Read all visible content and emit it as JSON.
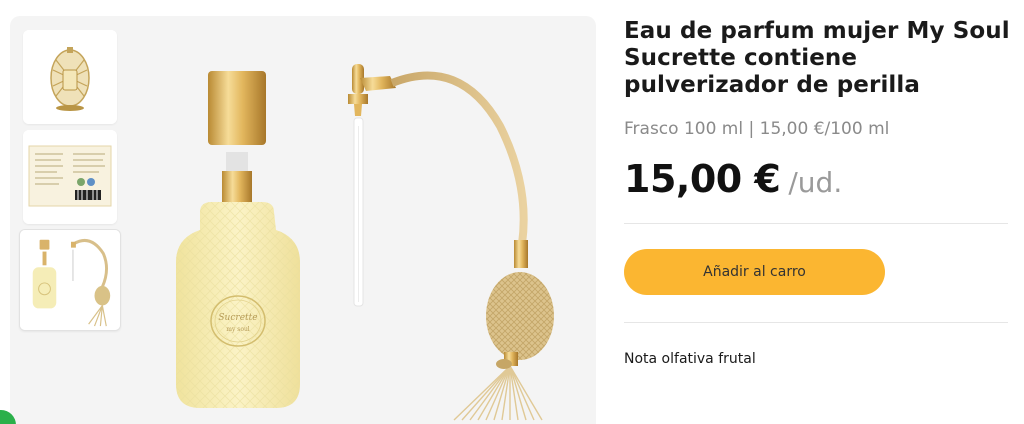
{
  "product": {
    "title": "Eau de parfum mujer My Soul Sucrette contiene pulverizador de perilla",
    "size_info": "Frasco 100 ml | 15,00 €/100 ml",
    "price": "15,00 €",
    "unit": "/ud.",
    "add_to_cart_label": "Añadir al carro",
    "note": "Nota olfativa frutal"
  },
  "gallery": {
    "thumbnails": [
      {
        "icon": "egg-perfume-image"
      },
      {
        "icon": "label-info-image"
      },
      {
        "icon": "bottle-and-bulb-image"
      }
    ],
    "main_image_icon": "perfume-bottle-with-atomizer-image",
    "bottle_label_text": "Sucrette",
    "bottle_label_sub": "my soul"
  },
  "colors": {
    "accent": "#fbb631",
    "badge": "#2bb04a"
  }
}
